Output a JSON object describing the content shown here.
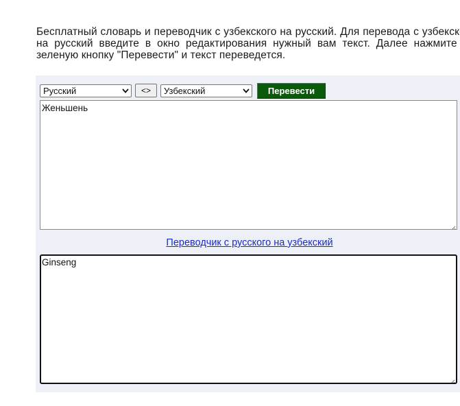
{
  "intro": {
    "text": "Бесплатный словарь и переводчик с узбекского на русский. Для перевода с узбекского на русский введите в окно редактирования нужный вам текст. Далее нажмите на зеленую кнопку \"Перевести\" и текст переведется."
  },
  "translator": {
    "source_language": "Русский",
    "swap_label": "<>",
    "target_language": "Узбекский",
    "translate_label": "Перевести",
    "translate_color": "#0b5a0b",
    "source_text": "Женьшень",
    "link_text": "Переводчик с русского на узбекский",
    "link_color": "#1c2cc0",
    "result_text": "Ginseng"
  }
}
